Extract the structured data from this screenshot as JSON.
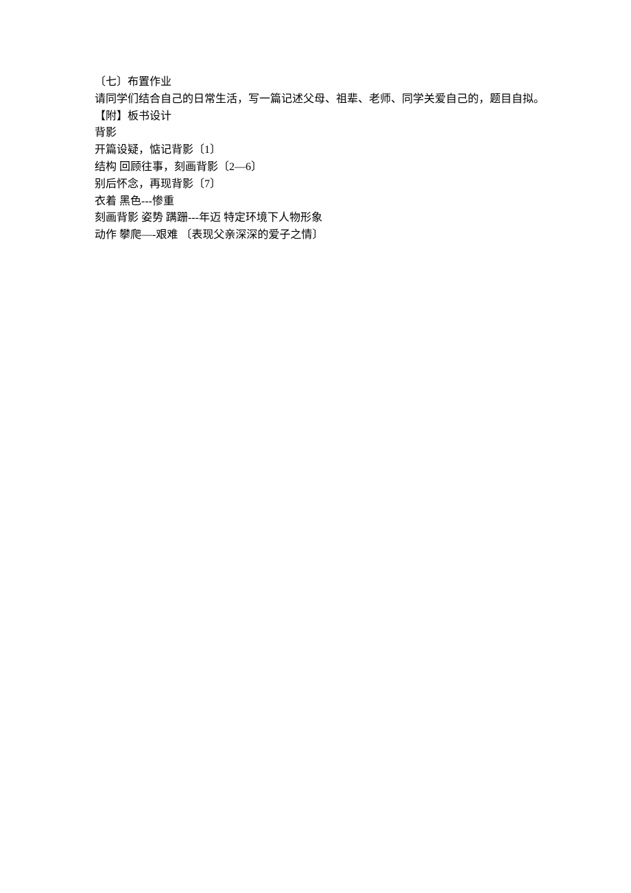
{
  "lines": {
    "l1": "〔七〕布置作业",
    "l2": "请同学们结合自己的日常生活，写一篇记述父母、祖辈、老师、同学关爱自己的，题目自拟。",
    "l3": "【附】板书设计",
    "l4": "背影",
    "l5": "开篇设疑，惦记背影〔1〕",
    "l6": "结构 回顾往事，刻画背影〔2—6〕",
    "l7": "别后怀念，再现背影〔7〕",
    "l8": "衣着 黑色---惨重",
    "l9": "刻画背影 姿势 蹒跚---年迈 特定环境下人物形象",
    "l10": "动作 攀爬—-艰难 〔表现父亲深深的爱子之情〕"
  }
}
